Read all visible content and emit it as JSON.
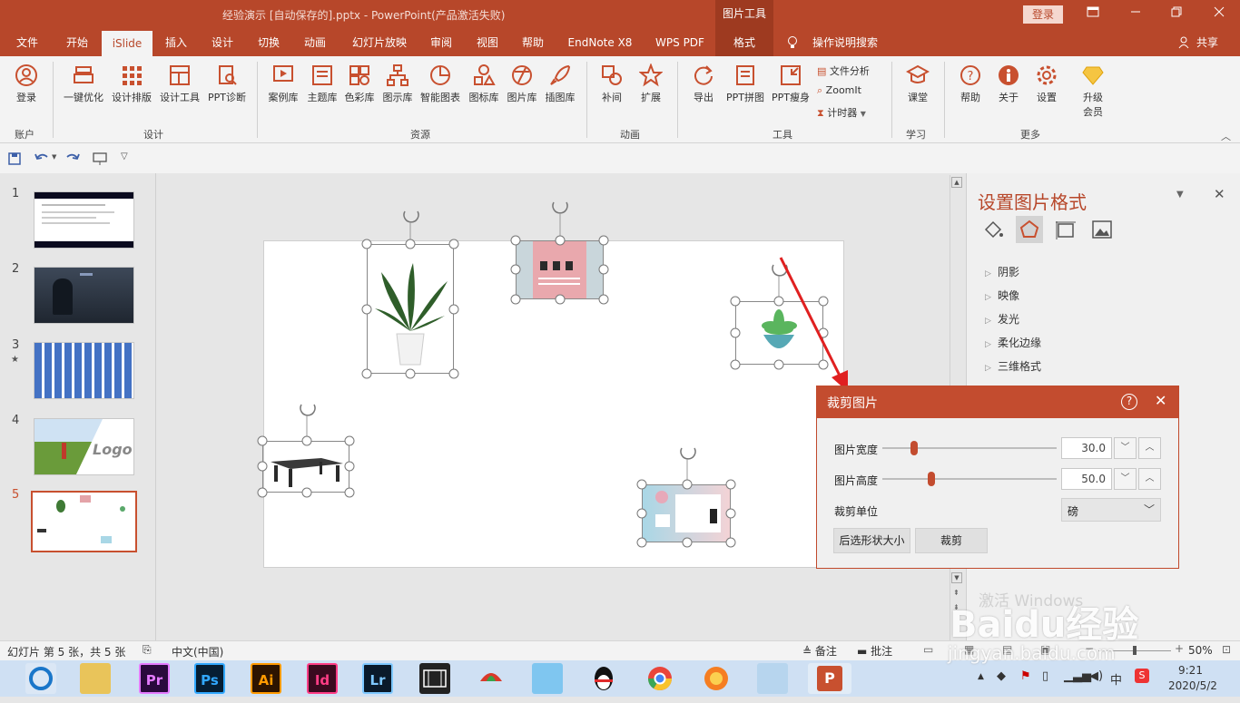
{
  "titlebar": {
    "doc_title": "经验演示 [自动保存的].pptx  -  PowerPoint(产品激活失败)",
    "contextual_tab_title": "图片工具",
    "login_label": "登录"
  },
  "tabs": [
    "文件",
    "开始",
    "iSlide",
    "插入",
    "设计",
    "切换",
    "动画",
    "幻灯片放映",
    "审阅",
    "视图",
    "帮助",
    "EndNote X8",
    "WPS PDF",
    "格式"
  ],
  "tell_me": "操作说明搜索",
  "share": "共享",
  "ribbon": {
    "buttons": [
      "登录",
      "一键优化",
      "设计排版",
      "设计工具",
      "PPT诊断",
      "案例库",
      "主题库",
      "色彩库",
      "图示库",
      "智能图表",
      "图标库",
      "图片库",
      "插图库",
      "补间",
      "扩展",
      "导出",
      "PPT拼图",
      "PPT瘦身",
      "课堂",
      "帮助",
      "关于",
      "设置",
      "升级会员"
    ],
    "small_buttons": [
      "文件分析",
      "ZoomIt",
      "计时器"
    ],
    "groups": [
      "账户",
      "设计",
      "资源",
      "动画",
      "工具",
      "学习",
      "更多"
    ]
  },
  "thumbnails": [
    "1",
    "2",
    "3",
    "4",
    "5"
  ],
  "thumb4_text": "Logo",
  "format_pane": {
    "title": "设置图片格式",
    "sections": [
      "阴影",
      "映像",
      "发光",
      "柔化边缘",
      "三维格式"
    ]
  },
  "dialog": {
    "title": "裁剪图片",
    "width_label": "图片宽度",
    "width_value": "30.0",
    "width_fraction": 0.16,
    "height_label": "图片高度",
    "height_value": "50.0",
    "height_fraction": 0.26,
    "unit_label": "裁剪单位",
    "unit_value": "磅",
    "btn_fit": "后选形状大小",
    "btn_crop": "裁剪"
  },
  "statusbar": {
    "slide_info": "幻灯片 第 5 张，共 5 张",
    "language": "中文(中国)",
    "notes": "备注",
    "comments": "批注",
    "zoom": "50%"
  },
  "taskbar": {
    "apps": [
      "Pr",
      "Ps",
      "Ai",
      "Id",
      "Lr"
    ],
    "time": "9:21",
    "date": "2020/5/2",
    "ime": "中"
  },
  "watermark": {
    "line1": "激活 Windows",
    "brand": "Baidu经验",
    "url": "jingyan.baidu.com"
  },
  "colors": {
    "accent": "#b7472a",
    "dialog_header": "#c34c2f"
  }
}
